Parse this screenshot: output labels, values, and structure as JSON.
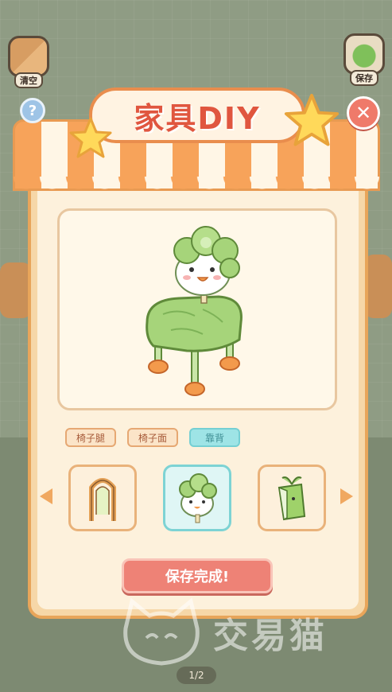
{
  "game": {
    "title": "家具DIY",
    "top_buttons": {
      "clear_label": "清空",
      "save_label": "保存"
    },
    "help_symbol": "?",
    "close_symbol": "✕"
  },
  "tabs": [
    {
      "label": "椅子腿",
      "active": false
    },
    {
      "label": "椅子面",
      "active": false
    },
    {
      "label": "靠背",
      "active": true
    }
  ],
  "parts": [
    {
      "icon": "arch-backrest-icon",
      "selected": false
    },
    {
      "icon": "cabbage-duck-backrest-icon",
      "selected": true
    },
    {
      "icon": "leaf-backrest-icon",
      "selected": false
    }
  ],
  "save_done_label": "保存完成!",
  "pager": "1/2",
  "watermark": "交易猫",
  "colors": {
    "accent_orange": "#f7a35a",
    "title_red": "#e0563f",
    "active_tab": "#9ee4e6",
    "save_button": "#ee8276",
    "close_button": "#ef7a6a"
  }
}
